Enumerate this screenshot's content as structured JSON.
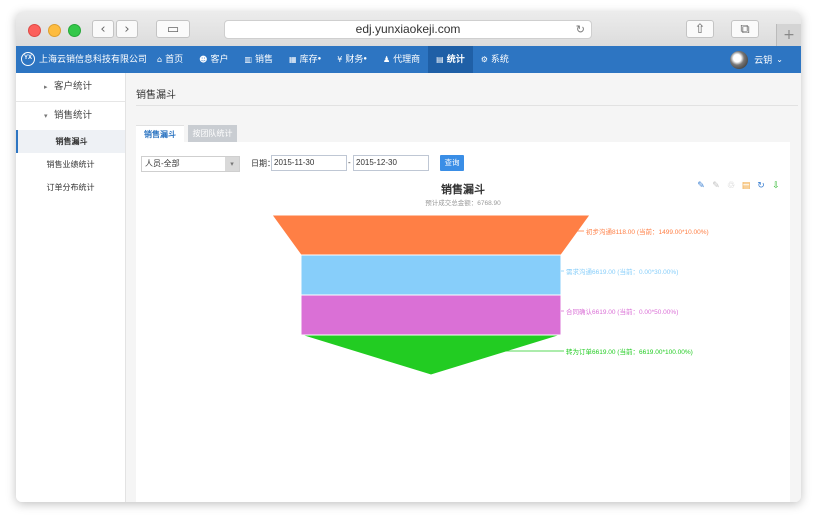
{
  "browser": {
    "url": "edj.yunxiaokeji.com",
    "back_glyph": "‹",
    "forward_glyph": "›",
    "sidebar_glyph": "▭",
    "reload_glyph": "↻",
    "share_glyph": "⇧",
    "tabs_glyph": "⧉",
    "new_tab_glyph": "+"
  },
  "app": {
    "logo_text": "YX",
    "company": "上海云销信息科技有限公司",
    "menu": [
      {
        "label": "首页",
        "icon": "home-icon",
        "glyph": "⌂",
        "badge": ""
      },
      {
        "label": "客户",
        "icon": "user-icon",
        "glyph": "☻",
        "badge": ""
      },
      {
        "label": "销售",
        "icon": "bar-chart-icon",
        "glyph": "▥",
        "badge": ""
      },
      {
        "label": "库存",
        "icon": "warehouse-icon",
        "glyph": "▦",
        "badge": "●"
      },
      {
        "label": "财务",
        "icon": "money-icon",
        "glyph": "¥",
        "badge": "●"
      },
      {
        "label": "代理商",
        "icon": "agents-icon",
        "glyph": "♟",
        "badge": ""
      },
      {
        "label": "统计",
        "icon": "stats-icon",
        "glyph": "▤",
        "badge": ""
      },
      {
        "label": "系统",
        "icon": "gear-icon",
        "glyph": "⚙",
        "badge": ""
      }
    ],
    "user_name": "云钥",
    "user_caret": "⌄",
    "colors": {
      "nav": "#2d75c2",
      "nav_active": "#1f5fa6",
      "accent": "#3a8ee6"
    }
  },
  "sidebar": {
    "group1": {
      "label": "客户统计",
      "caret": "▸"
    },
    "group2": {
      "label": "销售统计",
      "caret": "▾"
    },
    "items": [
      {
        "label": "销售漏斗"
      },
      {
        "label": "销售业绩统计"
      },
      {
        "label": "订单分布统计"
      }
    ]
  },
  "main": {
    "title": "销售漏斗",
    "tabs": [
      {
        "label": "销售漏斗"
      },
      {
        "label": "按团队统计"
      }
    ],
    "filters": {
      "person": "人员-全部",
      "person_arrow": "▾",
      "date_label": "日期：",
      "date_from": "2015-11-30",
      "date_sep": "-",
      "date_to": "2015-12-30",
      "query_label": "查询"
    },
    "toolbox": [
      {
        "icon": "pencil-icon",
        "glyph": "✎",
        "color": "#3a7fd1"
      },
      {
        "icon": "pencil-disabled-icon",
        "glyph": "✎",
        "color": "#c0c0c0"
      },
      {
        "icon": "trash-icon",
        "glyph": "♲",
        "color": "#c0c0c0"
      },
      {
        "icon": "data-view-icon",
        "glyph": "▤",
        "color": "#f0a030"
      },
      {
        "icon": "refresh-icon",
        "glyph": "↻",
        "color": "#3a7fd1"
      },
      {
        "icon": "save-icon",
        "glyph": "⇩",
        "color": "#2eb82e"
      }
    ]
  },
  "chart_data": {
    "type": "funnel",
    "title": "销售漏斗",
    "subtitle": "预计成交总金额：6768.90",
    "stages": [
      {
        "label": "初步沟通8118.00 (当前：1499.00*10.00%)",
        "color": "#ff7f45",
        "value": 8118.0
      },
      {
        "label": "需求沟通6619.00 (当前：0.00*30.00%)",
        "color": "#87cefa",
        "value": 6619.0
      },
      {
        "label": "合同确认6619.00 (当前：0.00*50.00%)",
        "color": "#da70d6",
        "value": 6619.0
      },
      {
        "label": "转为订单6619.00 (当前：6619.00*100.00%)",
        "color": "#22cc22",
        "value": 6619.0
      }
    ]
  }
}
